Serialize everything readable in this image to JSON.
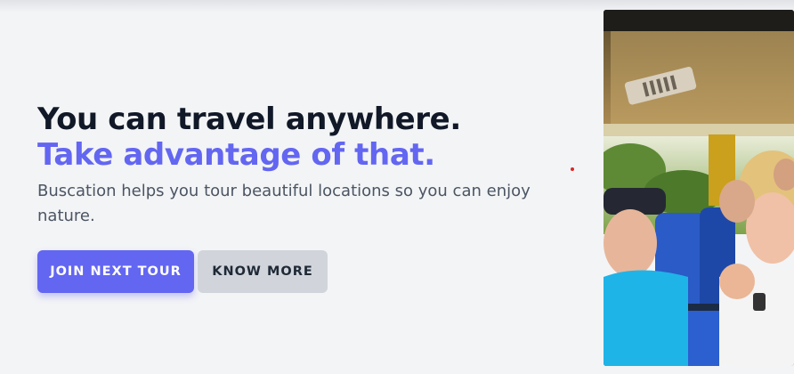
{
  "hero": {
    "headline_line1": "You can travel anywhere.",
    "headline_line2": "Take advantage of that.",
    "description": "Buscation helps you tour beautiful locations so you can enjoy nature."
  },
  "actions": {
    "primary_label": "JOIN NEXT TOUR",
    "secondary_label": "KNOW MORE"
  },
  "colors": {
    "accent": "#6366f1",
    "heading": "#111827",
    "body_text": "#4b5563",
    "background": "#f3f4f6",
    "secondary_button": "#d1d5db"
  },
  "image": {
    "subject": "bus-tour-passengers-photo"
  }
}
